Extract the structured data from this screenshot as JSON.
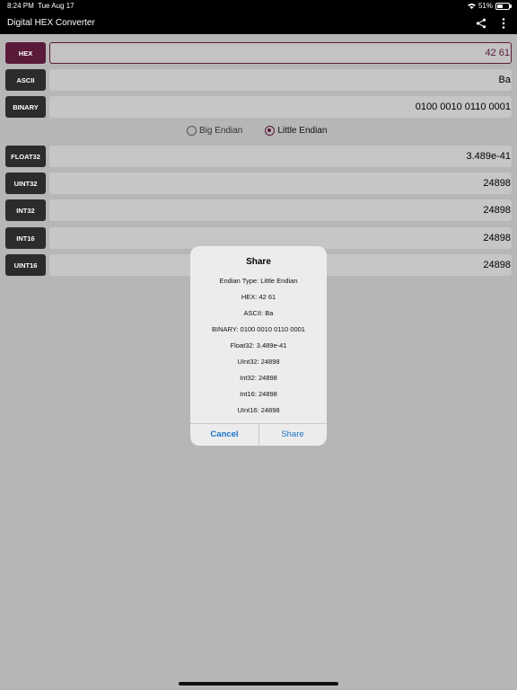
{
  "status": {
    "time": "8:24 PM",
    "date": "Tue Aug 17",
    "battery_text": "51%",
    "battery_level": 0.51
  },
  "app": {
    "title": "Digital HEX Converter",
    "share_icon": "share-icon",
    "more_icon": "more-vert-icon"
  },
  "fields": {
    "hex": {
      "label": "HEX",
      "value": "42 61"
    },
    "ascii": {
      "label": "ASCII",
      "value": "Ba"
    },
    "binary": {
      "label": "BINARY",
      "value": "0100 0010 0110 0001"
    },
    "float32": {
      "label": "FLOAT32",
      "value": "3.489e-41"
    },
    "uint32": {
      "label": "UINT32",
      "value": "24898"
    },
    "int32": {
      "label": "INT32",
      "value": "24898"
    },
    "int16": {
      "label": "INT16",
      "value": "24898"
    },
    "uint16": {
      "label": "UINT16",
      "value": "24898"
    }
  },
  "endian": {
    "big": "Big Endian",
    "little": "Little Endian",
    "selected": "little"
  },
  "dialog": {
    "title": "Share",
    "lines": [
      "Endian Type: Little Endian",
      "HEX: 42 61",
      "ASCII: Ba",
      "BINARY: 0100 0010 0110 0001",
      "Float32: 3.489e-41",
      "UInt32: 24898",
      "Int32: 24898",
      "Int16: 24898",
      "UInt16: 24898"
    ],
    "cancel": "Cancel",
    "share": "Share"
  },
  "colors": {
    "accent": "#5a1a39",
    "link": "#1a73c9"
  }
}
